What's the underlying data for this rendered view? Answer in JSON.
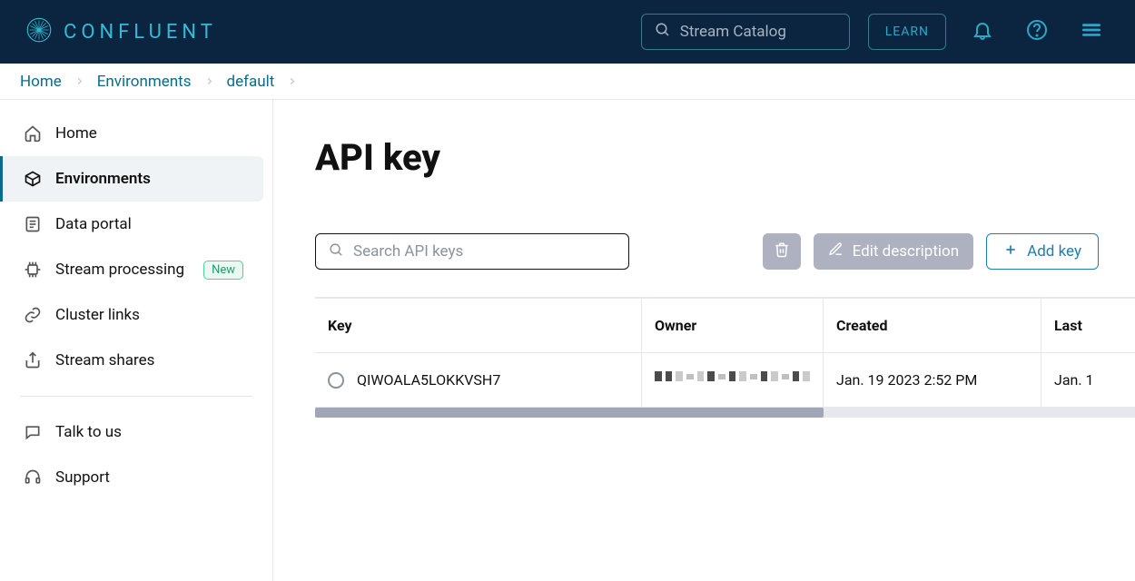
{
  "brand": "CONFLUENT",
  "topbar": {
    "search_placeholder": "Stream Catalog",
    "learn": "LEARN"
  },
  "breadcrumb": [
    "Home",
    "Environments",
    "default"
  ],
  "sidebar": {
    "items": [
      {
        "label": "Home"
      },
      {
        "label": "Environments"
      },
      {
        "label": "Data portal"
      },
      {
        "label": "Stream processing",
        "badge": "New"
      },
      {
        "label": "Cluster links"
      },
      {
        "label": "Stream shares"
      }
    ],
    "footer": [
      {
        "label": "Talk to us"
      },
      {
        "label": "Support"
      }
    ]
  },
  "page": {
    "title": "API key",
    "search_placeholder": "Search API keys",
    "edit_desc": "Edit description",
    "add_key": "Add key"
  },
  "table": {
    "columns": [
      "Key",
      "Owner",
      "Created",
      "Last"
    ],
    "rows": [
      {
        "key": "QIWOALA5LOKKVSH7",
        "created": "Jan. 19 2023 2:52 PM",
        "last": "Jan. 1"
      }
    ]
  }
}
